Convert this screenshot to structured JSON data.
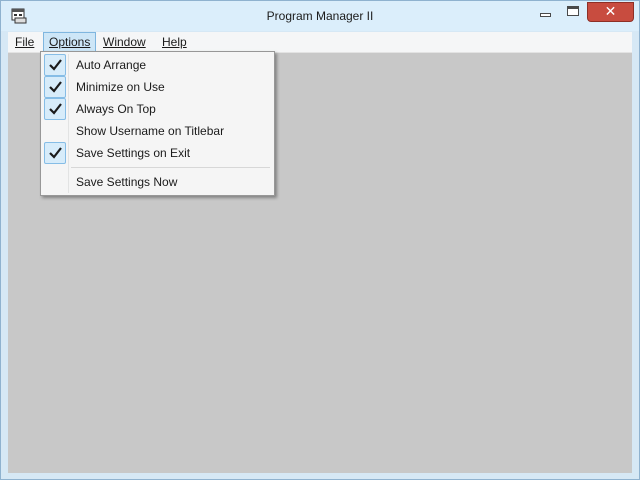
{
  "window": {
    "title": "Program Manager II",
    "close_glyph": "✕"
  },
  "menubar": {
    "file": "File",
    "options": "Options",
    "window": "Window",
    "help": "Help"
  },
  "options_menu": {
    "items": [
      {
        "label": "Auto Arrange",
        "checked": true
      },
      {
        "label": "Minimize on Use",
        "checked": true
      },
      {
        "label": "Always On Top",
        "checked": true
      },
      {
        "label": "Show Username on Titlebar",
        "checked": false
      },
      {
        "label": "Save Settings on Exit",
        "checked": true
      },
      {
        "label": "Save Settings Now",
        "checked": false
      }
    ]
  },
  "colors": {
    "client_background": "#c8c8c8",
    "check_highlight": "#d7ecfa",
    "close_button": "#c84c3f"
  }
}
